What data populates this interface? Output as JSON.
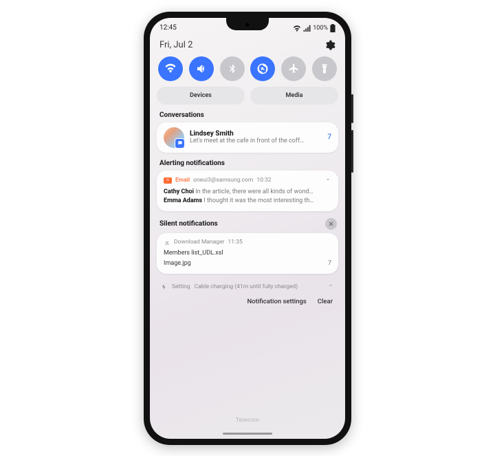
{
  "status": {
    "time": "12:45",
    "battery_pct": "100%"
  },
  "date": "Fri, Jul 2",
  "quick_settings": {
    "wifi": {
      "on": true
    },
    "sound": {
      "on": true
    },
    "bluetooth": {
      "on": false
    },
    "sync": {
      "on": true
    },
    "airplane": {
      "on": false
    },
    "flashlight": {
      "on": false
    }
  },
  "dm": {
    "devices": "Devices",
    "media": "Media"
  },
  "sections": {
    "conversations": "Conversations",
    "alerting": "Alerting notifications",
    "silent": "Silent notifications"
  },
  "conversation": {
    "name": "Lindsey Smith",
    "preview": "Let's meet at the cafe in front of the coff…",
    "badge": "7"
  },
  "alerting": {
    "app": "Email",
    "account": "oneui3@samsung.com",
    "time": "10:32",
    "items": [
      {
        "sender": "Cathy Choi",
        "text": "In the article, there were all kinds of wond…"
      },
      {
        "sender": "Emma Adams",
        "text": "I thought it was the most interesting th…"
      }
    ]
  },
  "silent": {
    "download": {
      "app": "Download Manager",
      "time": "11:35",
      "files": [
        "Members list_UDL.xsl",
        "Image.jpg"
      ],
      "count": "7"
    },
    "setting": {
      "app": "Setting",
      "text": "Cable charging (41m until fully charged)"
    }
  },
  "footer": {
    "settings": "Notification settings",
    "clear": "Clear"
  },
  "carrier": "Telecom"
}
